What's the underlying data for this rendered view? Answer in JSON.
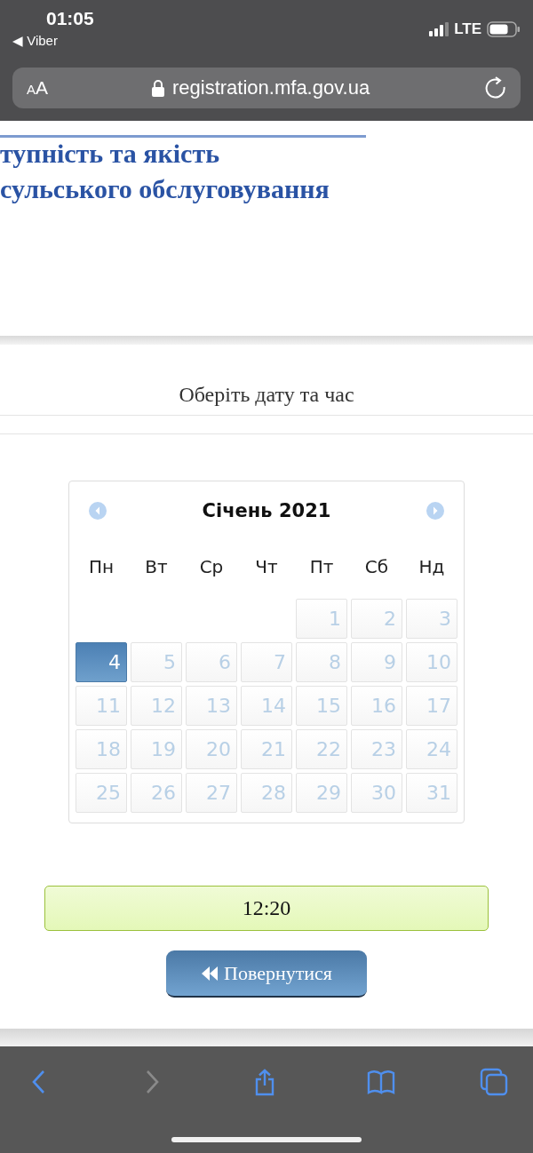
{
  "status_bar": {
    "time": "01:05",
    "back_link": "◀ Viber",
    "network": "LTE"
  },
  "address_bar": {
    "text_size": "AA",
    "url": "registration.mfa.gov.ua"
  },
  "site_header": {
    "lines": [
      "тупність та якість",
      "сульського обслуговування"
    ]
  },
  "section_title": "Оберіть дату та час",
  "calendar": {
    "month": "Січень 2021",
    "weekdays": [
      "Пн",
      "Вт",
      "Ср",
      "Чт",
      "Пт",
      "Сб",
      "Нд"
    ],
    "weeks": [
      [
        {
          "kind": "empty"
        },
        {
          "kind": "empty"
        },
        {
          "kind": "empty"
        },
        {
          "kind": "empty"
        },
        {
          "kind": "day",
          "label": "1",
          "selected": false
        },
        {
          "kind": "day",
          "label": "2",
          "selected": false
        },
        {
          "kind": "day",
          "label": "3",
          "selected": false
        }
      ],
      [
        {
          "kind": "day",
          "label": "4",
          "selected": true
        },
        {
          "kind": "day",
          "label": "5",
          "selected": false
        },
        {
          "kind": "day",
          "label": "6",
          "selected": false
        },
        {
          "kind": "day",
          "label": "7",
          "selected": false
        },
        {
          "kind": "day",
          "label": "8",
          "selected": false
        },
        {
          "kind": "day",
          "label": "9",
          "selected": false
        },
        {
          "kind": "day",
          "label": "10",
          "selected": false
        }
      ],
      [
        {
          "kind": "day",
          "label": "11",
          "selected": false
        },
        {
          "kind": "day",
          "label": "12",
          "selected": false
        },
        {
          "kind": "day",
          "label": "13",
          "selected": false
        },
        {
          "kind": "day",
          "label": "14",
          "selected": false
        },
        {
          "kind": "day",
          "label": "15",
          "selected": false
        },
        {
          "kind": "day",
          "label": "16",
          "selected": false
        },
        {
          "kind": "day",
          "label": "17",
          "selected": false
        }
      ],
      [
        {
          "kind": "day",
          "label": "18",
          "selected": false
        },
        {
          "kind": "day",
          "label": "19",
          "selected": false
        },
        {
          "kind": "day",
          "label": "20",
          "selected": false
        },
        {
          "kind": "day",
          "label": "21",
          "selected": false
        },
        {
          "kind": "day",
          "label": "22",
          "selected": false
        },
        {
          "kind": "day",
          "label": "23",
          "selected": false
        },
        {
          "kind": "day",
          "label": "24",
          "selected": false
        }
      ],
      [
        {
          "kind": "day",
          "label": "25",
          "selected": false
        },
        {
          "kind": "day",
          "label": "26",
          "selected": false
        },
        {
          "kind": "day",
          "label": "27",
          "selected": false
        },
        {
          "kind": "day",
          "label": "28",
          "selected": false
        },
        {
          "kind": "day",
          "label": "29",
          "selected": false
        },
        {
          "kind": "day",
          "label": "30",
          "selected": false
        },
        {
          "kind": "day",
          "label": "31",
          "selected": false
        }
      ]
    ]
  },
  "time_slot": {
    "label": "12:20"
  },
  "back_button": {
    "label": "Повернутися"
  },
  "toolbar": [
    {
      "kind": "back",
      "disabled": false
    },
    {
      "kind": "forward",
      "disabled": true
    },
    {
      "kind": "share",
      "disabled": false
    },
    {
      "kind": "bookmarks",
      "disabled": false
    },
    {
      "kind": "tabs",
      "disabled": false
    }
  ]
}
